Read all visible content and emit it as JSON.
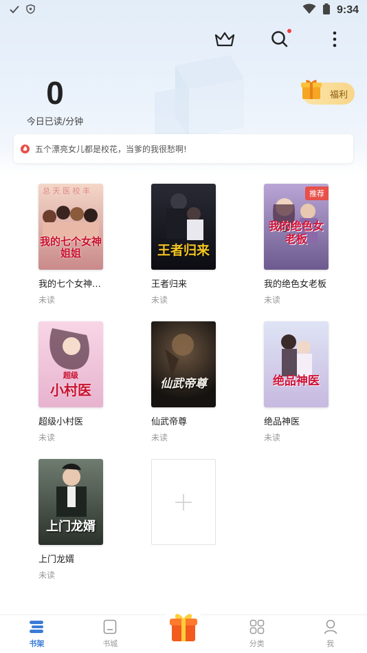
{
  "status_bar": {
    "time": "9:34"
  },
  "reading": {
    "value": "0",
    "label": "今日已读/分钟"
  },
  "welfare": {
    "label": "福利"
  },
  "notice": {
    "text": "五个漂亮女儿都是校花，当爹的我很愁啊!"
  },
  "books": [
    {
      "title": "我的七个女神…",
      "status": "未读",
      "cover_title": "我的七个女神姐姐",
      "cover_colors": [
        "#f4d7c8",
        "#c98a8a"
      ],
      "accent": "#c8102e",
      "recommended": false
    },
    {
      "title": "王者归来",
      "status": "未读",
      "cover_title": "王者归来",
      "cover_colors": [
        "#2a2a35",
        "#0c0c12"
      ],
      "accent": "#f3c623",
      "recommended": false
    },
    {
      "title": "我的绝色女老板",
      "status": "未读",
      "cover_title": "我的绝色女老板",
      "cover_colors": [
        "#b9a6d6",
        "#6d5a8e"
      ],
      "accent": "#d2143a",
      "recommended": true,
      "badge": "推荐"
    },
    {
      "title": "超级小村医",
      "status": "未读",
      "cover_title": "小村医",
      "cover_sub": "超级",
      "cover_colors": [
        "#f8d6e6",
        "#e7b3cf"
      ],
      "accent": "#c8102e",
      "recommended": false
    },
    {
      "title": "仙武帝尊",
      "status": "未读",
      "cover_title": "仙武帝尊",
      "cover_colors": [
        "#4a3a2c",
        "#15120f"
      ],
      "accent": "#f2efe8",
      "recommended": false
    },
    {
      "title": "绝品神医",
      "status": "未读",
      "cover_title": "绝品神医",
      "cover_colors": [
        "#dfe4f5",
        "#c7b9e0"
      ],
      "accent": "#d2143a",
      "recommended": false
    },
    {
      "title": "上门龙婿",
      "status": "未读",
      "cover_title": "上门龙婿",
      "cover_colors": [
        "#6f7c70",
        "#2b322b"
      ],
      "accent": "#ffffff",
      "recommended": false
    }
  ],
  "tabs": [
    {
      "label": "书架",
      "icon": "bookshelf-icon",
      "active": true
    },
    {
      "label": "书城",
      "icon": "bookstore-icon",
      "active": false
    },
    {
      "label": "",
      "icon": "gift-icon",
      "active": false
    },
    {
      "label": "分类",
      "icon": "category-icon",
      "active": false
    },
    {
      "label": "我",
      "icon": "profile-icon",
      "active": false
    }
  ],
  "colors": {
    "accent": "#3a7bd5",
    "welfare_bg": "#f8d68a",
    "notice_dot": "#e8504a"
  }
}
